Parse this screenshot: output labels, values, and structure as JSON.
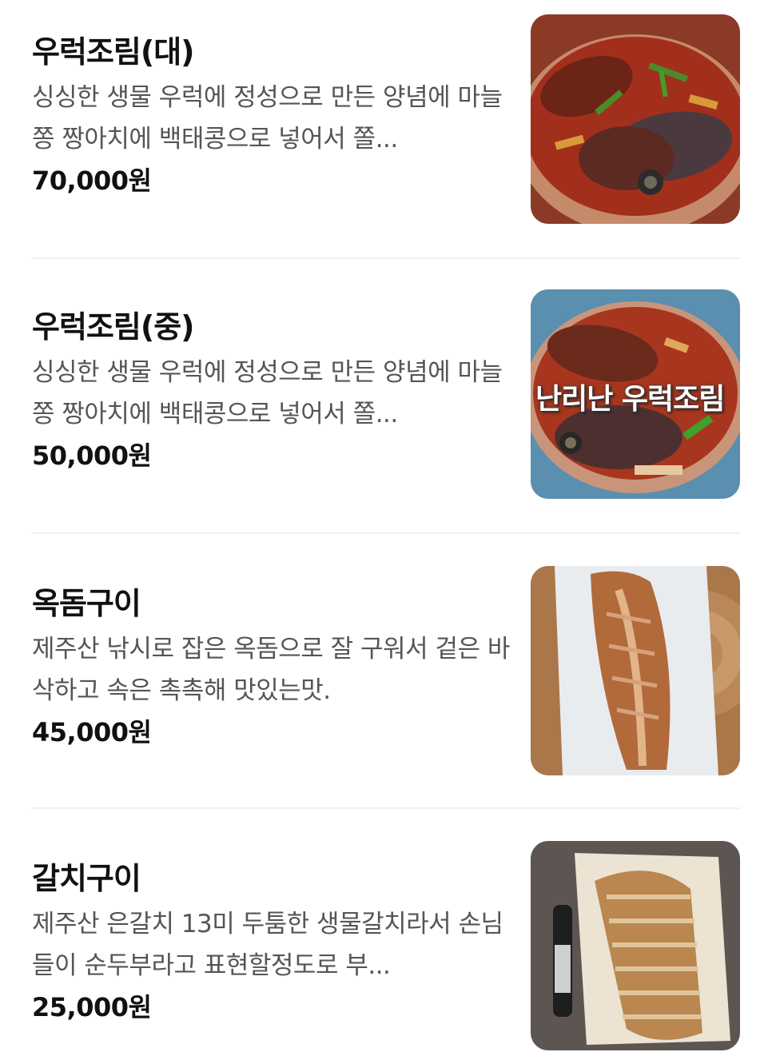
{
  "menu": {
    "items": [
      {
        "name": "우럭조림(대)",
        "description": "싱싱한 생물 우럭에 정성으로 만든 양념에 마늘쫑 짱아치에 백태콩으로 넣어서 쫄...",
        "price": "70,000원",
        "image_label": "braised-rockfish-photo"
      },
      {
        "name": "우럭조림(중)",
        "description": "싱싱한 생물 우럭에 정성으로 만든 양념에 마늘쫑 짱아치에 백태콩으로 넣어서 쫄...",
        "price": "50,000원",
        "image_label": "braised-rockfish-photo",
        "image_overlay_text": "난리난 우럭조림"
      },
      {
        "name": "옥돔구이",
        "description": "제주산 낚시로 잡은 옥돔으로 잘 구워서 겉은 바삭하고 속은 촉촉해 맛있는맛.",
        "price": "45,000원",
        "image_label": "grilled-tilefish-photo"
      },
      {
        "name": "갈치구이",
        "description": "제주산 은갈치 13미 두툼한 생물갈치라서 손님들이 순두부라고 표현할정도로 부...",
        "price": "25,000원",
        "image_label": "grilled-hairtail-photo"
      }
    ]
  },
  "colors": {
    "text_primary": "#111111",
    "text_secondary": "#555555",
    "divider": "#f0f0f0"
  }
}
